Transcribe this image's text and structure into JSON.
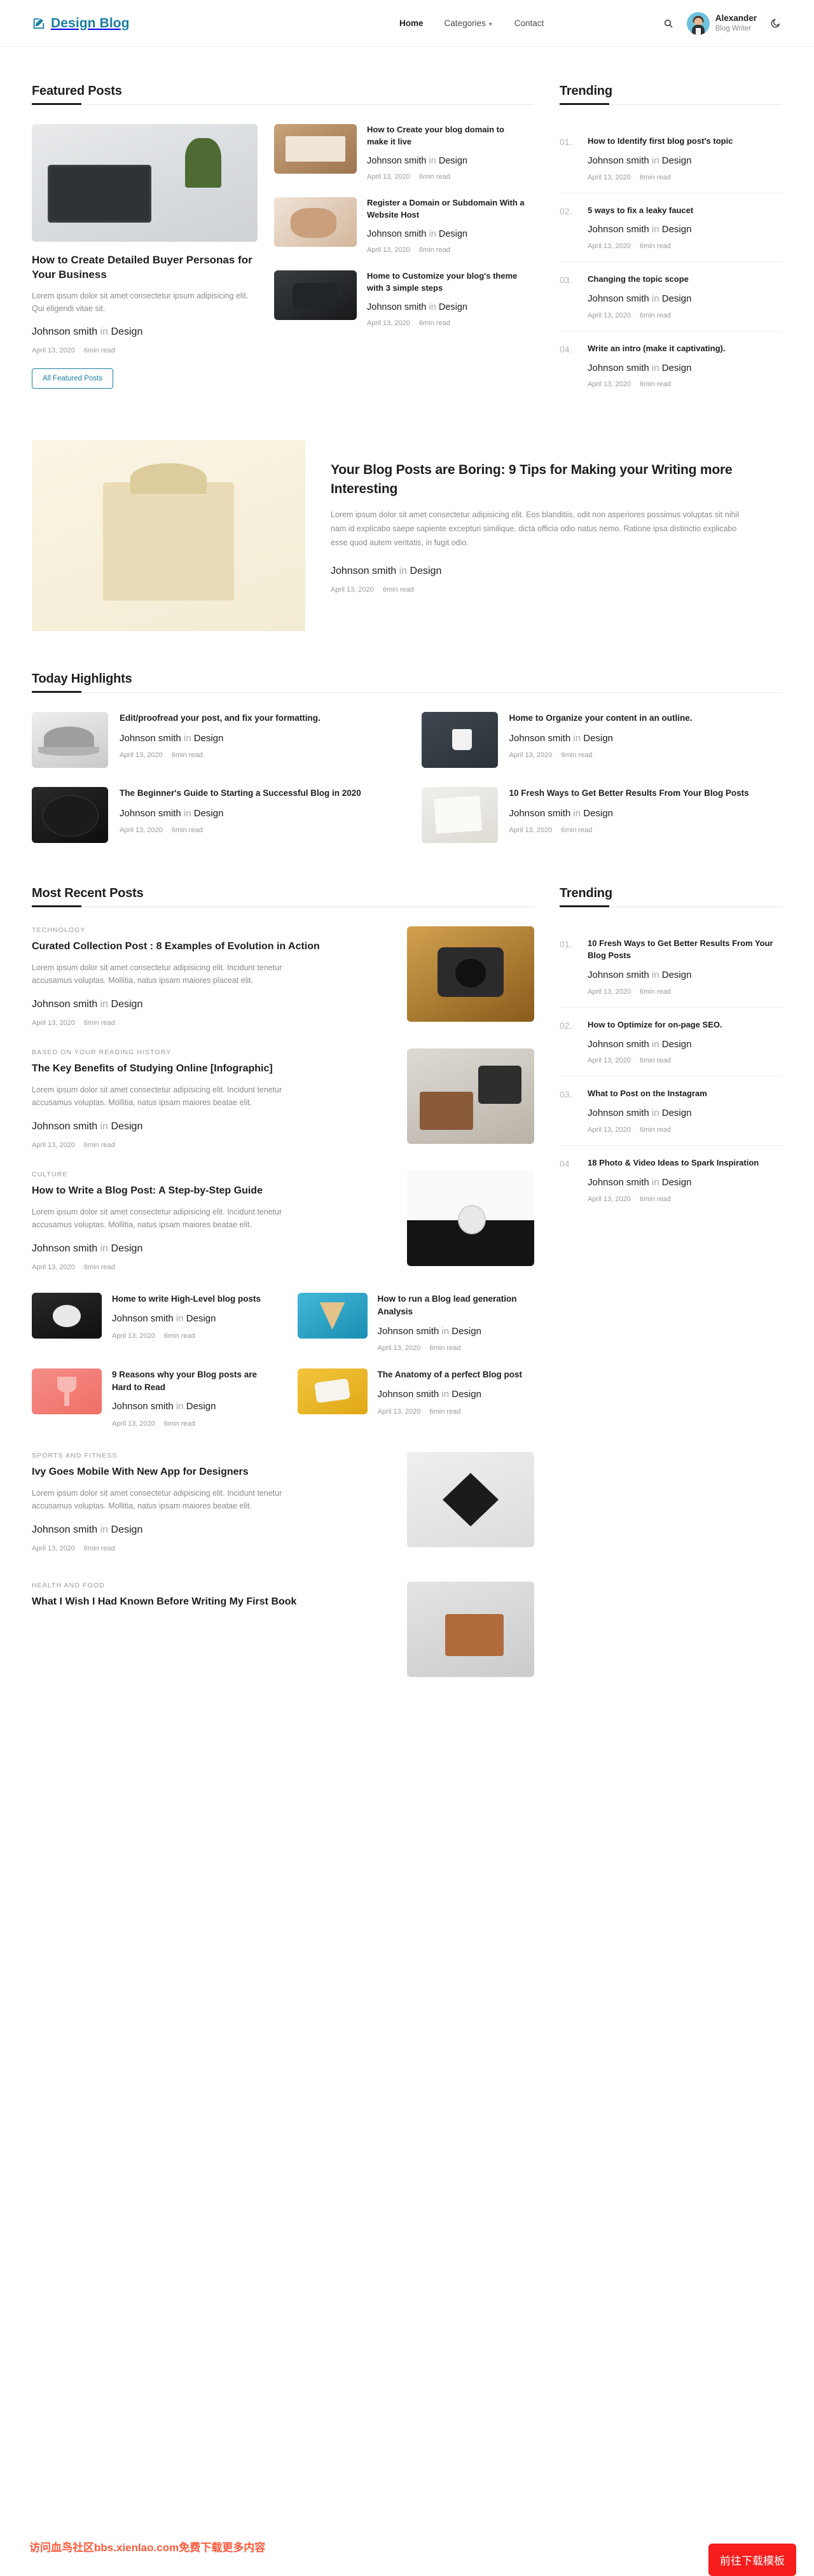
{
  "header": {
    "brand": "Design Blog",
    "brand_color": "#1a7fa0",
    "nav": [
      {
        "label": "Home",
        "active": true
      },
      {
        "label": "Categories",
        "active": false,
        "has_caret": true
      },
      {
        "label": "Contact",
        "active": false
      }
    ],
    "search_icon": "search-icon",
    "theme_icon": "moon-icon",
    "user": {
      "name": "Alexander",
      "role": "Blog Writer"
    }
  },
  "common": {
    "author": "Johnson smith",
    "in": "in",
    "category": "Design",
    "date": "April 13, 2020",
    "read_time": "6min read"
  },
  "featured": {
    "heading": "Featured Posts",
    "main": {
      "title": "How to Create Detailed Buyer Personas for Your Business",
      "excerpt": "Lorem ipsum dolor sit amet consectetur ipsum adipisicing elit. Qui eligendi vitae sit.",
      "author": "Johnson smith",
      "in": "in",
      "category": "Design",
      "date": "April 13, 2020",
      "read_time": "6min read",
      "button": "All Featured Posts"
    },
    "side": [
      {
        "title": "How to Create your blog domain to make it live",
        "author": "Johnson smith",
        "in": "in",
        "category": "Design",
        "date": "April 13, 2020",
        "read_time": "6min read"
      },
      {
        "title": "Register a Domain or Subdomain With a Website Host",
        "author": "Johnson smith",
        "in": "in",
        "category": "Design",
        "date": "April 13, 2020",
        "read_time": "6min read"
      },
      {
        "title": "Home to Customize your blog's theme with 3 simple steps",
        "author": "Johnson smith",
        "in": "in",
        "category": "Design",
        "date": "April 13, 2020",
        "read_time": "6min read"
      }
    ]
  },
  "trending_top": {
    "heading": "Trending",
    "items": [
      {
        "num": "01.",
        "title": "How to Identify first blog post's topic",
        "author": "Johnson smith",
        "in": "in",
        "category": "Design",
        "date": "April 13, 2020",
        "read_time": "6min read"
      },
      {
        "num": "02.",
        "title": "5 ways to fix a leaky faucet",
        "author": "Johnson smith",
        "in": "in",
        "category": "Design",
        "date": "April 13, 2020",
        "read_time": "6min read"
      },
      {
        "num": "03.",
        "title": "Changing the topic scope",
        "author": "Johnson smith",
        "in": "in",
        "category": "Design",
        "date": "April 13, 2020",
        "read_time": "6min read"
      },
      {
        "num": "04.",
        "title": "Write an intro (make it captivating).",
        "author": "Johnson smith",
        "in": "in",
        "category": "Design",
        "date": "April 13, 2020",
        "read_time": "6min read"
      }
    ]
  },
  "hero": {
    "title": "Your Blog Posts are Boring: 9 Tips for Making your Writing more Interesting",
    "excerpt": "Lorem ipsum dolor sit amet consectetur adipisicing elit. Eos blanditiis, odit non asperiores possimus voluptas sit nihil nam id explicabo saepe sapiente excepturi similique, dicta officia odio natus nemo. Ratione ipsa distinctio explicabo esse quod autem veritatis, in fugit odio.",
    "author": "Johnson smith",
    "in": "in",
    "category": "Design",
    "date": "April 13, 2020",
    "read_time": "6min read"
  },
  "highlights": {
    "heading": "Today Highlights",
    "items": [
      {
        "title": "Edit/proofread your post, and fix your formatting.",
        "author": "Johnson smith",
        "in": "in",
        "category": "Design",
        "date": "April 13, 2020",
        "read_time": "6min read"
      },
      {
        "title": "Home to Organize your content in an outline.",
        "author": "Johnson smith",
        "in": "in",
        "category": "Design",
        "date": "April 13, 2020",
        "read_time": "6min read"
      },
      {
        "title": "The Beginner's Guide to Starting a Successful Blog in 2020",
        "author": "Johnson smith",
        "in": "in",
        "category": "Design",
        "date": "April 13, 2020",
        "read_time": "6min read"
      },
      {
        "title": "10 Fresh Ways to Get Better Results From Your Blog Posts",
        "author": "Johnson smith",
        "in": "in",
        "category": "Design",
        "date": "April 13, 2020",
        "read_time": "6min read"
      }
    ]
  },
  "recent": {
    "heading": "Most Recent Posts",
    "large": [
      {
        "cat": "TECHNOLOGY",
        "title": "Curated Collection Post : 8 Examples of Evolution in Action",
        "excerpt": "Lorem ipsum dolor sit amet consectetur adipisicing elit. Incidunt tenetur accusamus voluptas. Mollitia, natus ipsam maiores placeat elit.",
        "author": "Johnson smith",
        "in": "in",
        "category": "Design",
        "date": "April 13, 2020",
        "read_time": "6min read"
      },
      {
        "cat": "BASED ON YOUR READING HISTORY",
        "title": "The Key Benefits of Studying Online [Infographic]",
        "excerpt": "Lorem ipsum dolor sit amet consectetur adipisicing elit. Incidunt tenetur accusamus voluptas. Mollitia, natus ipsam maiores beatae elit.",
        "author": "Johnson smith",
        "in": "in",
        "category": "Design",
        "date": "April 13, 2020",
        "read_time": "6min read"
      },
      {
        "cat": "CULTURE",
        "title": "How to Write a Blog Post: A Step-by-Step Guide",
        "excerpt": "Lorem ipsum dolor sit amet consectetur adipisicing elit. Incidunt tenetur accusamus voluptas. Mollitia, natus ipsam maiores beatae elit.",
        "author": "Johnson smith",
        "in": "in",
        "category": "Design",
        "date": "April 13, 2020",
        "read_time": "6min read"
      }
    ],
    "small": [
      {
        "title": "Home to write High-Level blog posts",
        "author": "Johnson smith",
        "in": "in",
        "category": "Design",
        "date": "April 13, 2020",
        "read_time": "6min read"
      },
      {
        "title": "How to run a Blog lead generation Analysis",
        "author": "Johnson smith",
        "in": "in",
        "category": "Design",
        "date": "April 13, 2020",
        "read_time": "6min read"
      },
      {
        "title": "9 Reasons why your Blog posts are Hard to Read",
        "author": "Johnson smith",
        "in": "in",
        "category": "Design",
        "date": "April 13, 2020",
        "read_time": "6min read"
      },
      {
        "title": "The Anatomy of a perfect Blog post",
        "author": "Johnson smith",
        "in": "in",
        "category": "Design",
        "date": "April 13, 2020",
        "read_time": "6min read"
      }
    ],
    "large_tail": [
      {
        "cat": "SPORTS AND FITNESS",
        "title": "Ivy Goes Mobile With New App for Designers",
        "excerpt": "Lorem ipsum dolor sit amet consectetur adipisicing elit. Incidunt tenetur accusamus voluptas. Mollitia, natus ipsam maiores beatae elit.",
        "author": "Johnson smith",
        "in": "in",
        "category": "Design",
        "date": "April 13, 2020",
        "read_time": "6min read"
      },
      {
        "cat": "HEALTH AND FOOD",
        "title": "What I Wish I Had Known Before Writing My First Book",
        "excerpt": "",
        "author": "",
        "in": "",
        "category": "",
        "date": "",
        "read_time": ""
      }
    ]
  },
  "trending_bottom": {
    "heading": "Trending",
    "items": [
      {
        "num": "01.",
        "title": "10 Fresh Ways to Get Better Results From Your Blog Posts",
        "author": "Johnson smith",
        "in": "in",
        "category": "Design",
        "date": "April 13, 2020",
        "read_time": "6min read"
      },
      {
        "num": "02.",
        "title": "How to Optimize for on-page SEO.",
        "author": "Johnson smith",
        "in": "in",
        "category": "Design",
        "date": "April 13, 2020",
        "read_time": "6min read"
      },
      {
        "num": "03.",
        "title": "What to Post on the Instagram",
        "author": "Johnson smith",
        "in": "in",
        "category": "Design",
        "date": "April 13, 2020",
        "read_time": "6min read"
      },
      {
        "num": "04",
        "title": "18 Photo & Video Ideas to Spark Inspiration",
        "author": "Johnson smith",
        "in": "in",
        "category": "Design",
        "date": "April 13, 2020",
        "read_time": "6min read"
      }
    ]
  },
  "overlay": {
    "cta_label": "前往下载模板",
    "cta_color": "#f71d1d",
    "watermark": "访问血鸟社区bbs.xienlao.com免费下载更多内容"
  }
}
